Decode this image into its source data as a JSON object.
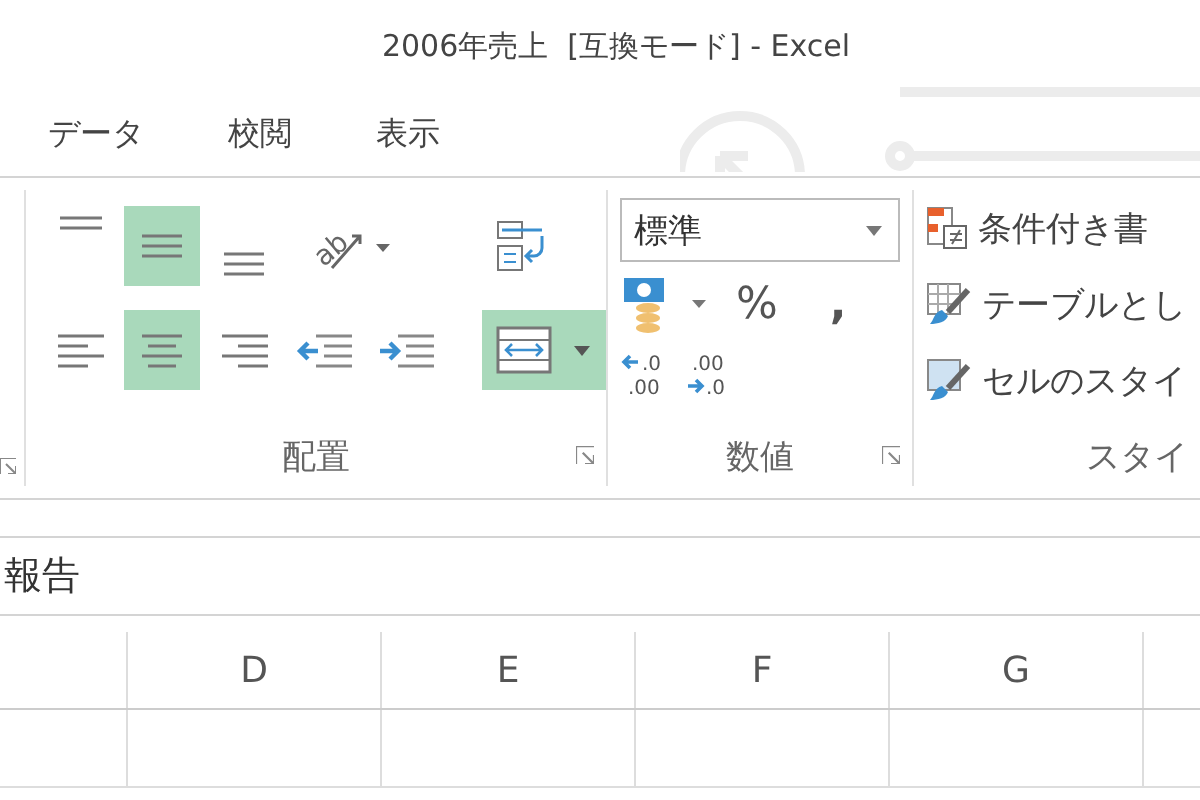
{
  "window": {
    "title": "2006年売上  [互換モード] - Excel"
  },
  "tabs": [
    {
      "label": "データ",
      "selected": false
    },
    {
      "label": "校閲",
      "selected": false
    },
    {
      "label": "表示",
      "selected": false
    }
  ],
  "alignment": {
    "label": "配置",
    "rows": [
      [
        {
          "kind": "align-top",
          "selected": false
        },
        {
          "kind": "align-middle",
          "selected": true
        },
        {
          "kind": "align-bottom",
          "selected": false
        },
        {
          "kind": "orientation",
          "glyph": "ab",
          "selected": false
        }
      ],
      [
        {
          "kind": "align-left",
          "selected": false
        },
        {
          "kind": "align-center",
          "selected": true
        },
        {
          "kind": "align-right",
          "selected": false
        },
        {
          "kind": "indent-decrease",
          "selected": false
        },
        {
          "kind": "indent-increase",
          "selected": false
        }
      ]
    ],
    "wrap": {
      "selected": false
    },
    "merge": {
      "selected": true
    }
  },
  "number": {
    "label": "数値",
    "format": "標準",
    "percent": "%",
    "comma": ",",
    "decimals": [
      {
        "kind": "increase",
        "top": ".0",
        "bottom": ".00"
      },
      {
        "kind": "decrease",
        "top": ".00",
        "bottom": ".0"
      }
    ]
  },
  "styles": {
    "label": "スタイ",
    "items": [
      {
        "kind": "conditional",
        "label": "条件付き書"
      },
      {
        "kind": "table",
        "label": "テーブルとし"
      },
      {
        "kind": "cell",
        "label": "セルのスタイ"
      }
    ]
  },
  "formula_bar": {
    "value": "報告"
  },
  "columns": [
    "D",
    "E",
    "F",
    "G"
  ]
}
